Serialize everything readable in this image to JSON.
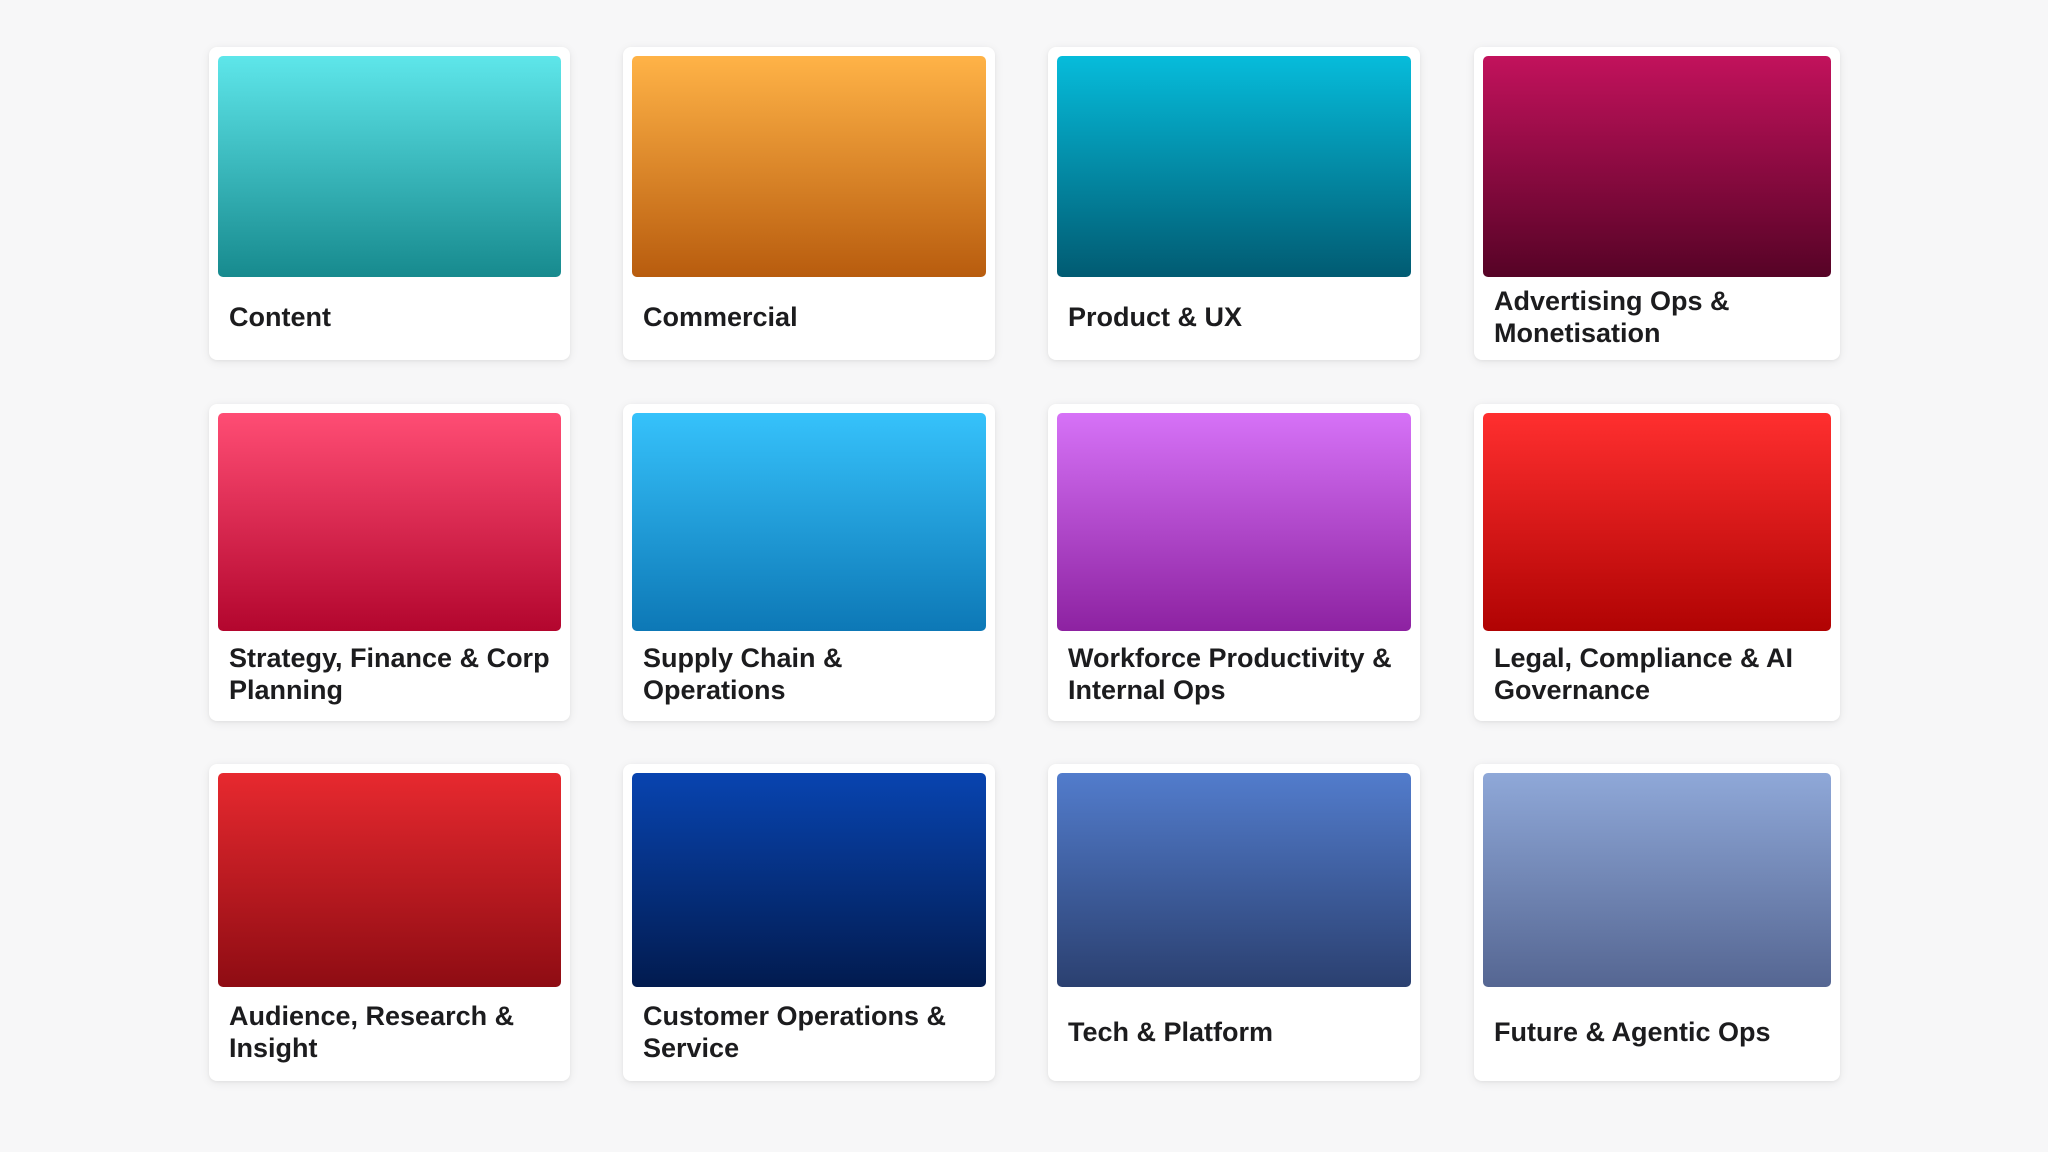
{
  "cards": [
    {
      "label": "Content",
      "gradient": [
        "#5ee6ea",
        "#178a8e"
      ]
    },
    {
      "label": "Commercial",
      "gradient": [
        "#ffb347",
        "#b85c0e"
      ]
    },
    {
      "label": "Product & UX",
      "gradient": [
        "#06bcdb",
        "#015b72"
      ]
    },
    {
      "label": "Advertising Ops & Monetisation",
      "gradient": [
        "#c2125c",
        "#560326"
      ]
    },
    {
      "label": "Strategy, Finance & Corp Planning",
      "gradient": [
        "#ff4d74",
        "#b3062e"
      ]
    },
    {
      "label": "Supply Chain & Operations",
      "gradient": [
        "#36c2fb",
        "#0d78b6"
      ]
    },
    {
      "label": "Workforce Productivity & Internal Ops",
      "gradient": [
        "#d672f7",
        "#8d22a1"
      ]
    },
    {
      "label": "Legal, Compliance & AI Governance",
      "gradient": [
        "#ff2f2f",
        "#b00303"
      ]
    },
    {
      "label": "Audience, Research & Insight",
      "gradient": [
        "#e7292f",
        "#8e0c13"
      ]
    },
    {
      "label": "Customer Operations & Service",
      "gradient": [
        "#0844b0",
        "#021b4f"
      ]
    },
    {
      "label": "Tech & Platform",
      "gradient": [
        "#527ccc",
        "#2b4070"
      ]
    },
    {
      "label": "Future & Agentic Ops",
      "gradient": [
        "#8fa8d8",
        "#556692"
      ]
    }
  ]
}
